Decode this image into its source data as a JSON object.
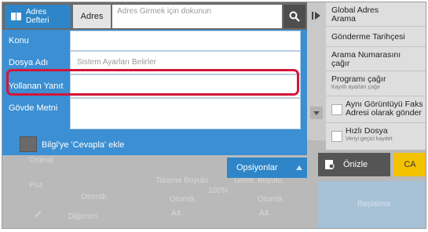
{
  "topbar": {
    "address_book_label": "Adres Defteri",
    "address_label": "Adres",
    "address_placeholder": "Adres Girmek için dokunun"
  },
  "form": {
    "subject_label": "Konu",
    "filename_label": "Dosya Adı",
    "filename_placeholder": "Sistem Ayarları Belirler",
    "reply_to_label": "Yollanan Yanıt",
    "body_label": "Gövde Metni",
    "bcc_label": "Bilgi'ye 'Cevapla' ekle"
  },
  "menu": {
    "global_search": "Global Adres Arama",
    "send_history": "Gönderme Tarihçesi",
    "call_number": "Arama Numarasını çağır",
    "call_program": "Programı çağır",
    "call_program_sub": "Kayıtlı ayarları çağır",
    "same_image_fax": "Aynı Görüntüyü Faks Adresi olarak gönder",
    "quick_file": "Hızlı Dosya",
    "quick_file_sub": "Veriyi geçici kaydet"
  },
  "bottom": {
    "original": "Orijinal",
    "poz": "Poz",
    "otomtk": "Otomtk",
    "others": "Diğerleri",
    "scan_size": "Tarama Boyutu",
    "send_size": "Gönd. Boyutu",
    "ratio": "100%",
    "a4": "A4",
    "options": "Opsiyonlar",
    "preview": "Önizle",
    "ca": "CA",
    "start": "Başlatma"
  }
}
